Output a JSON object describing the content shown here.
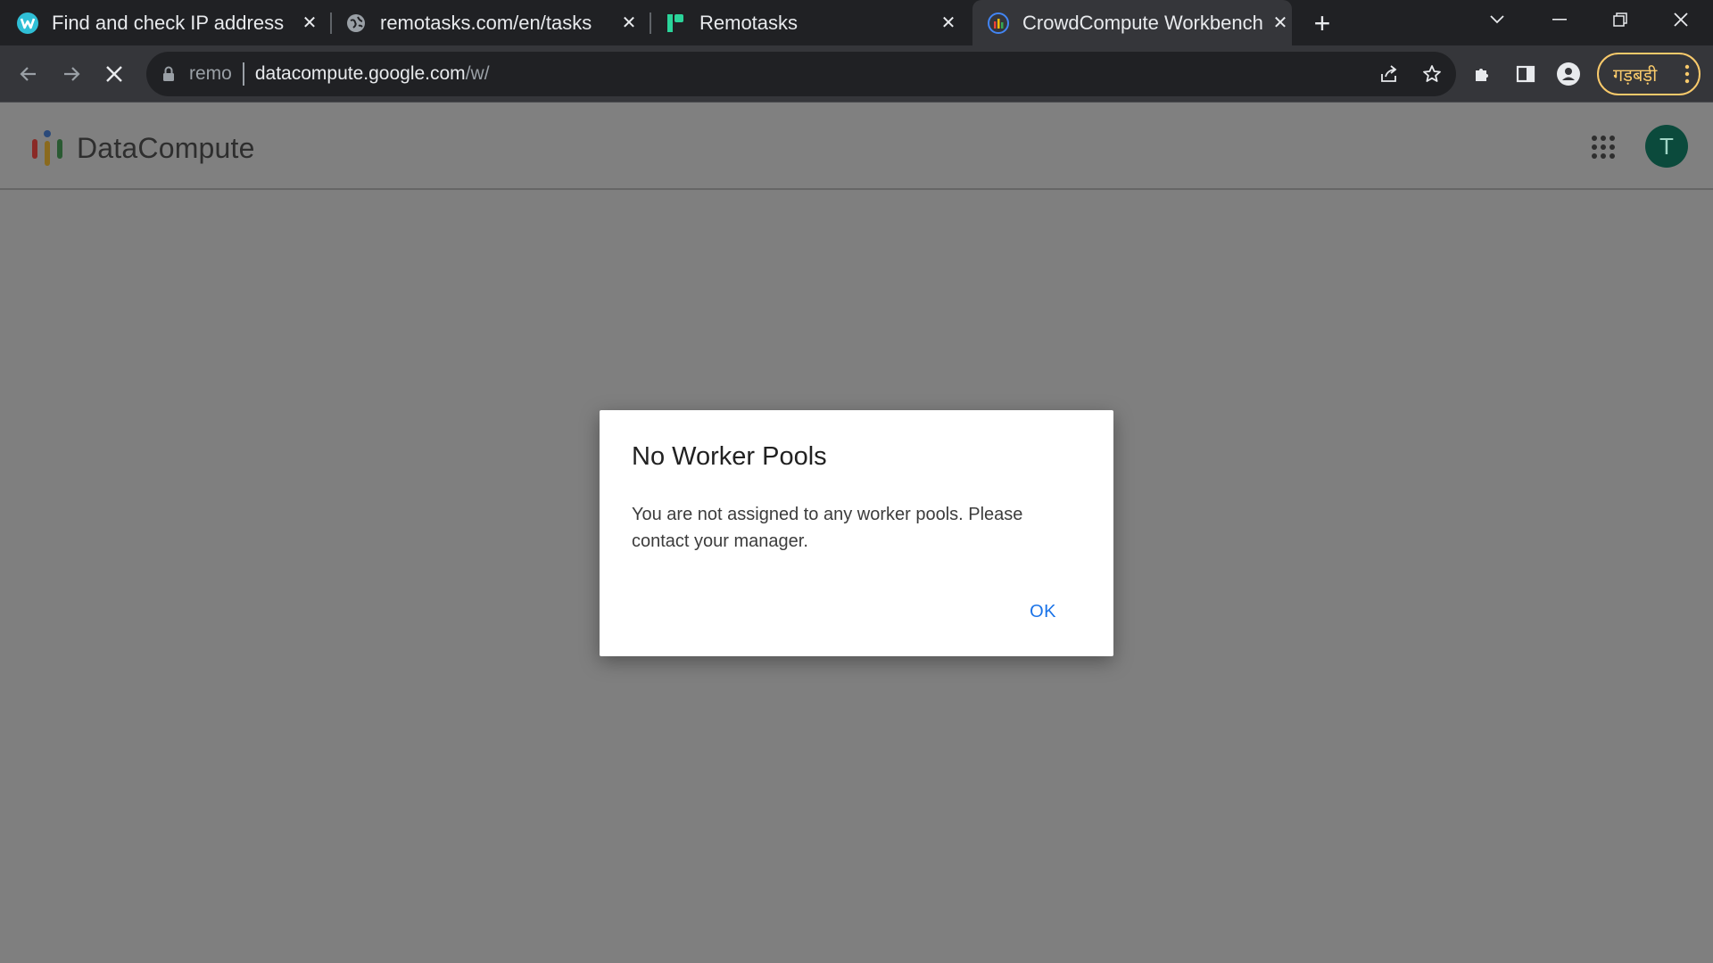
{
  "browser": {
    "tabs": [
      {
        "title": "Find and check IP address",
        "favicon": "whoer-w-icon"
      },
      {
        "title": "remotasks.com/en/tasks",
        "favicon": "globe-icon"
      },
      {
        "title": "Remotasks",
        "favicon": "remotasks-icon"
      },
      {
        "title": "CrowdCompute Workbench",
        "favicon": "crowdcompute-icon",
        "active": true
      }
    ],
    "address_bar": {
      "chip": "remo",
      "host": "datacompute.google.com",
      "path": "/w/"
    },
    "profile_label": "गड़बड़ी",
    "colors": {
      "profile_accent": "#f9ca6b",
      "tab_bg": "#202124",
      "active_tab_bg": "#35363a"
    }
  },
  "app": {
    "brand": "DataCompute",
    "avatar_initial": "T",
    "avatar_color": "#0b4a3c"
  },
  "dialog": {
    "title": "No Worker Pools",
    "message": "You are not assigned to any worker pools. Please contact your manager.",
    "ok_label": "OK",
    "accent": "#1a73e8"
  }
}
